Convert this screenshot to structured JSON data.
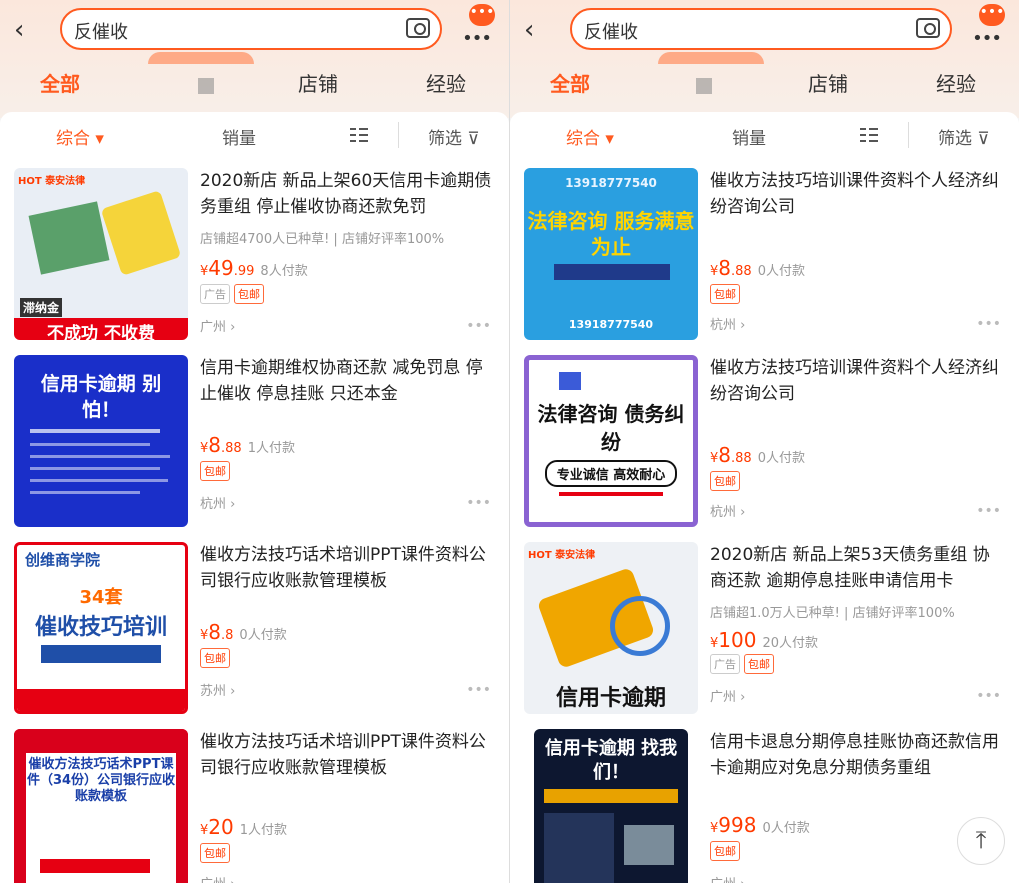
{
  "left": {
    "search_query": "反催收",
    "bubble": "•••",
    "tabs": {
      "all": "全部",
      "shop": "店铺",
      "exp": "经验"
    },
    "sort": {
      "comprehensive": "综合 ▾",
      "sales": "销量",
      "filter": "筛选 ⊽"
    },
    "products": [
      {
        "title": "2020新店 新品上架60天信用卡逾期债务重组 停止催收协商还款免罚",
        "subtitle": "店铺超4700人已种草! | 店铺好评率100%",
        "price_prefix": "¥",
        "price_int": "49",
        "price_dec": ".99",
        "buyers": "8人付款",
        "tag_ad": "广告",
        "tag_ship": "包邮",
        "location": "广州 ›",
        "thumb_top": "HOT 泰安法律",
        "thumb_main": "不成功 不收费",
        "thumb_side": "滞纳金"
      },
      {
        "title": "信用卡逾期维权协商还款 减免罚息 停止催收 停息挂账 只还本金",
        "price_prefix": "¥",
        "price_int": "8",
        "price_dec": ".88",
        "buyers": "1人付款",
        "tag_ship": "包邮",
        "location": "杭州 ›",
        "thumb_main": "信用卡逾期 别怕！"
      },
      {
        "title": "催收方法技巧话术培训PPT课件资料公司银行应收账款管理模板",
        "price_prefix": "¥",
        "price_int": "8",
        "price_dec": ".8",
        "buyers": "0人付款",
        "tag_ship": "包邮",
        "location": "苏州 ›",
        "thumb_top": "创维商学院",
        "thumb_main": "催收技巧培训",
        "thumb_side": "34套"
      },
      {
        "title": "催收方法技巧话术培训PPT课件资料公司银行应收账款管理模板",
        "price_prefix": "¥",
        "price_int": "20",
        "price_dec": "",
        "buyers": "1人付款",
        "tag_ship": "包邮",
        "location": "广州 ›",
        "thumb_main": "催收方法技巧话术PPT课件（34份）公司银行应收账款模板"
      }
    ]
  },
  "right": {
    "search_query": "反催收",
    "bubble": "•••",
    "tabs": {
      "all": "全部",
      "shop": "店铺",
      "exp": "经验"
    },
    "sort": {
      "comprehensive": "综合 ▾",
      "sales": "销量",
      "filter": "筛选 ⊽"
    },
    "products": [
      {
        "title": "催收方法技巧培训课件资料个人经济纠纷咨询公司",
        "price_prefix": "¥",
        "price_int": "8",
        "price_dec": ".88",
        "buyers": "0人付款",
        "tag_ship": "包邮",
        "location": "杭州 ›",
        "thumb_top": "13918777540",
        "thumb_main": "法律咨询 服务满意为止",
        "thumb_side": "13918777540"
      },
      {
        "title": "催收方法技巧培训课件资料个人经济纠纷咨询公司",
        "price_prefix": "¥",
        "price_int": "8",
        "price_dec": ".88",
        "buyers": "0人付款",
        "tag_ship": "包邮",
        "location": "杭州 ›",
        "thumb_main": "法律咨询 债务纠纷",
        "thumb_side": "专业诚信 高效耐心"
      },
      {
        "title": "2020新店 新品上架53天债务重组 协商还款 逾期停息挂账申请信用卡",
        "subtitle": "店铺超1.0万人已种草! | 店铺好评率100%",
        "price_prefix": "¥",
        "price_int": "100",
        "price_dec": "",
        "buyers": "20人付款",
        "tag_ad": "广告",
        "tag_ship": "包邮",
        "location": "广州 ›",
        "thumb_top": "HOT 泰安法律",
        "thumb_main": "信用卡逾期"
      },
      {
        "title": "信用卡退息分期停息挂账协商还款信用卡逾期应对免息分期债务重组",
        "price_prefix": "¥",
        "price_int": "998",
        "price_dec": "",
        "buyers": "0人付款",
        "tag_ship": "包邮",
        "location": "广州 ›",
        "thumb_main": "信用卡逾期 找我们！"
      }
    ]
  },
  "colors": {
    "accent": "#ff5a1f",
    "price": "#ff3a00"
  }
}
